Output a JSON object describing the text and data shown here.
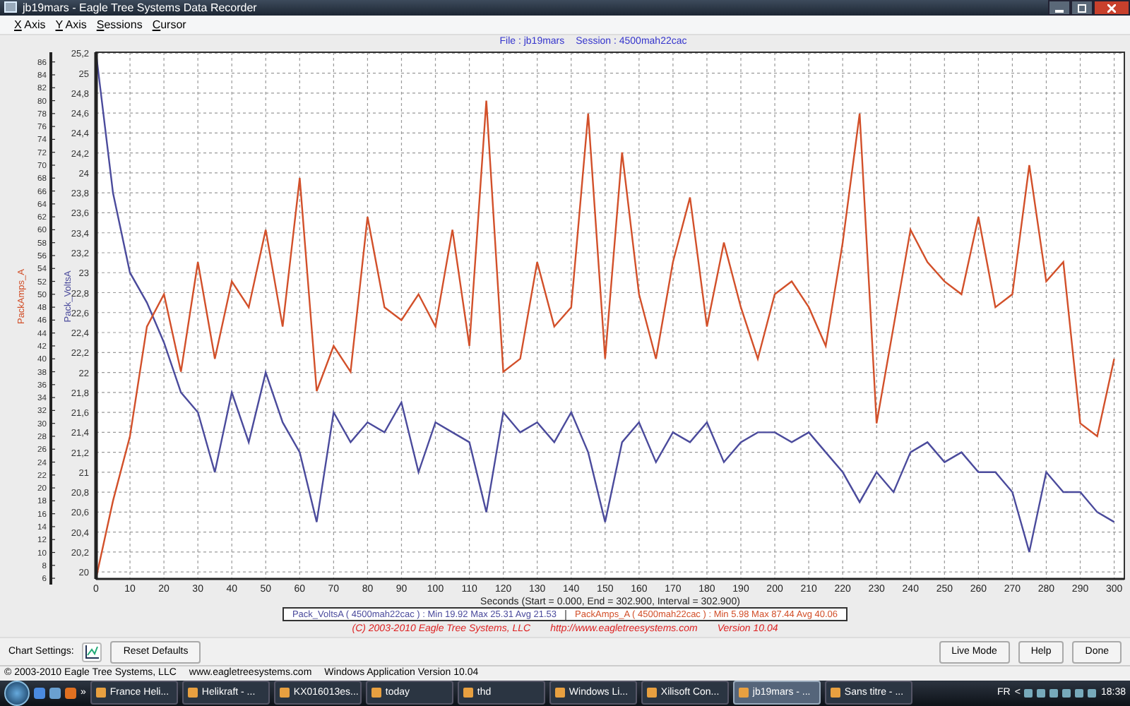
{
  "window": {
    "title": "jb19mars - Eagle Tree Systems Data Recorder"
  },
  "menu": [
    "X Axis",
    "Y Axis",
    "Sessions",
    "Cursor"
  ],
  "chart": {
    "file_label": "File : jb19mars",
    "session_label": "Session : 4500mah22cac",
    "chart_data": {
      "type": "line",
      "grid": true,
      "xlabel": "Seconds (Start = 0.000,  End = 302.900,  Interval =  302.900)",
      "ylabel": "Pack_VoltsA",
      "y2label": "PackAmps_A",
      "x": [
        0,
        5,
        10,
        15,
        20,
        25,
        30,
        35,
        40,
        45,
        50,
        55,
        60,
        65,
        70,
        75,
        80,
        85,
        90,
        95,
        100,
        105,
        110,
        115,
        120,
        125,
        130,
        135,
        140,
        145,
        150,
        155,
        160,
        165,
        170,
        175,
        180,
        185,
        190,
        195,
        200,
        205,
        210,
        215,
        220,
        225,
        230,
        235,
        240,
        245,
        250,
        255,
        260,
        265,
        270,
        275,
        280,
        285,
        290,
        295,
        300
      ],
      "series": [
        {
          "name": "Pack_VoltsA",
          "color": "#4b4b9c",
          "axis": "y",
          "values": [
            25.2,
            23.8,
            23.0,
            22.7,
            22.3,
            21.8,
            21.6,
            21.0,
            21.8,
            21.3,
            22.0,
            21.5,
            21.2,
            20.5,
            21.6,
            21.3,
            21.5,
            21.4,
            21.7,
            21.0,
            21.5,
            21.4,
            21.3,
            20.6,
            21.6,
            21.4,
            21.5,
            21.3,
            21.6,
            21.2,
            20.5,
            21.3,
            21.5,
            21.1,
            21.4,
            21.3,
            21.5,
            21.1,
            21.3,
            21.4,
            21.4,
            21.3,
            21.4,
            21.2,
            21.0,
            20.7,
            21.0,
            20.8,
            21.2,
            21.3,
            21.1,
            21.2,
            21.0,
            21.0,
            20.8,
            20.2,
            21.0,
            20.8,
            20.8,
            20.6,
            20.5
          ]
        },
        {
          "name": "PackAmps_A",
          "color": "#d2502a",
          "axis": "y2",
          "values": [
            6,
            18,
            28,
            45,
            50,
            38,
            55,
            40,
            52,
            48,
            60,
            45,
            68,
            35,
            42,
            38,
            62,
            48,
            46,
            50,
            45,
            60,
            42,
            80,
            38,
            40,
            55,
            45,
            48,
            78,
            40,
            72,
            50,
            40,
            55,
            65,
            45,
            58,
            48,
            40,
            50,
            52,
            48,
            42,
            58,
            78,
            30,
            45,
            60,
            55,
            52,
            50,
            62,
            48,
            50,
            70,
            52,
            55,
            30,
            28,
            40
          ]
        }
      ],
      "xlim": [
        0,
        303
      ],
      "ylim": [
        19.93,
        25.21
      ],
      "y2lim": [
        5.9,
        87.5
      ],
      "xticks": [
        0,
        10,
        20,
        30,
        40,
        50,
        60,
        70,
        80,
        90,
        100,
        110,
        120,
        130,
        140,
        150,
        160,
        170,
        180,
        190,
        200,
        210,
        220,
        230,
        240,
        250,
        260,
        270,
        280,
        290,
        300
      ],
      "yticks": [
        20,
        {
          "value": 20.2,
          "label": "20,2"
        },
        {
          "value": 20.4,
          "label": "20,4"
        },
        {
          "value": 20.6,
          "label": "20,6"
        },
        {
          "value": 20.8,
          "label": "20,8"
        },
        21,
        {
          "value": 21.2,
          "label": "21,2"
        },
        {
          "value": 21.4,
          "label": "21,4"
        },
        {
          "value": 21.6,
          "label": "21,6"
        },
        {
          "value": 21.8,
          "label": "21,8"
        },
        22,
        {
          "value": 22.2,
          "label": "22,2"
        },
        {
          "value": 22.4,
          "label": "22,4"
        },
        {
          "value": 22.6,
          "label": "22,6"
        },
        {
          "value": 22.8,
          "label": "22,8"
        },
        23,
        {
          "value": 23.2,
          "label": "23,2"
        },
        {
          "value": 23.4,
          "label": "23,4"
        },
        {
          "value": 23.6,
          "label": "23,6"
        },
        {
          "value": 23.8,
          "label": "23,8"
        },
        24,
        {
          "value": 24.2,
          "label": "24,2"
        },
        {
          "value": 24.4,
          "label": "24,4"
        },
        {
          "value": 24.6,
          "label": "24,6"
        },
        {
          "value": 24.8,
          "label": "24,8"
        },
        25,
        {
          "value": 25.2,
          "label": "25,2"
        }
      ],
      "y2ticks": [
        6,
        8,
        10,
        12,
        14,
        16,
        18,
        20,
        22,
        24,
        26,
        28,
        30,
        32,
        34,
        36,
        38,
        40,
        42,
        44,
        46,
        48,
        50,
        52,
        54,
        56,
        58,
        60,
        62,
        64,
        66,
        68,
        70,
        72,
        74,
        76,
        78,
        80,
        82,
        84,
        86
      ]
    },
    "legend": [
      {
        "text": "( 4500mah22cac ) : Min 19.92  Max 25.31  Avg 21.53"
      },
      {
        "text": "( 4500mah22cac ) : Min 5.98  Max 87.44  Avg 40.06"
      }
    ],
    "credits": [
      "(C) 2003-2010 Eagle Tree Systems, LLC",
      "http://www.eagletreesystems.com",
      "Version 10.04"
    ]
  },
  "toolbar": {
    "label": "Chart Settings:",
    "left_buttons": [
      "Reset Defaults"
    ],
    "right_buttons": [
      "Live Mode",
      "Help",
      "Done"
    ]
  },
  "status_bar": [
    "© 2003-2010 Eagle Tree Systems, LLC",
    "www.eagletreesystems.com",
    "Windows Application Version 10.04"
  ],
  "taskbar": {
    "overflow": "»",
    "tasks": [
      {
        "label": "France Heli...",
        "selected": false
      },
      {
        "label": "Helikraft - ...",
        "selected": false
      },
      {
        "label": "KX016013es...",
        "selected": false
      },
      {
        "label": "today",
        "selected": false
      },
      {
        "label": "thd",
        "selected": false
      },
      {
        "label": "Windows Li...",
        "selected": false
      },
      {
        "label": "Xilisoft Con...",
        "selected": false
      },
      {
        "label": "jb19mars - ...",
        "selected": true
      },
      {
        "label": "Sans titre - ...",
        "selected": false
      }
    ],
    "language": "FR",
    "tray_toggle": "<",
    "clock": "18:38"
  }
}
